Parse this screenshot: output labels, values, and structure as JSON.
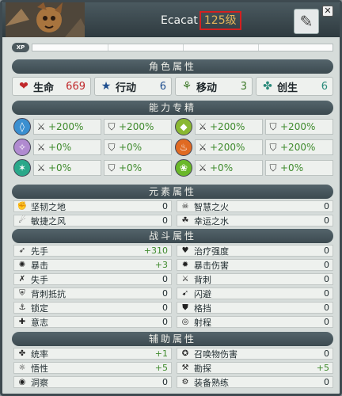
{
  "header": {
    "name": "Ecacat",
    "level": "125级"
  },
  "xp": {
    "badge": "XP"
  },
  "sections": {
    "character": "角色属性",
    "abilities": "能力专精",
    "elemental": "元素属性",
    "combat": "战斗属性",
    "support": "辅助属性"
  },
  "primary": [
    {
      "label": "生命",
      "value": "669",
      "color": "#c0282a",
      "icon": "heart-icon"
    },
    {
      "label": "行动",
      "value": "6",
      "color": "#1f4f8f",
      "icon": "star-icon"
    },
    {
      "label": "移动",
      "value": "3",
      "color": "#3e7a2a",
      "icon": "boot-icon"
    },
    {
      "label": "创生",
      "value": "6",
      "color": "#2a8a7a",
      "icon": "wakfu-icon"
    }
  ],
  "elements": [
    {
      "icon": "water-icon",
      "color": "#3a8fd0",
      "attack": "+200%",
      "defense": "+200%"
    },
    {
      "icon": "earth-icon",
      "color": "#8ab832",
      "attack": "+200%",
      "defense": "+200%"
    },
    {
      "icon": "light-icon",
      "color": "#b08ad0",
      "attack": "+0%",
      "defense": "+0%"
    },
    {
      "icon": "fire-icon",
      "color": "#e06a22",
      "attack": "+200%",
      "defense": "+200%"
    },
    {
      "icon": "wind-icon",
      "color": "#2aa88a",
      "attack": "+0%",
      "defense": "+0%"
    },
    {
      "icon": "nature-icon",
      "color": "#6ab82a",
      "attack": "+0%",
      "defense": "+0%"
    }
  ],
  "elemental_rows": [
    {
      "label": "坚韧之地",
      "value": "0"
    },
    {
      "label": "智慧之火",
      "value": "0"
    },
    {
      "label": "敏捷之风",
      "value": "0"
    },
    {
      "label": "幸运之水",
      "value": "0"
    }
  ],
  "combat_rows": [
    {
      "label": "先手",
      "value": "+310",
      "green": true
    },
    {
      "label": "治疗强度",
      "value": "0"
    },
    {
      "label": "暴击",
      "value": "+3",
      "green": true
    },
    {
      "label": "暴击伤害",
      "value": "0"
    },
    {
      "label": "失手",
      "value": "0"
    },
    {
      "label": "背刺",
      "value": "0"
    },
    {
      "label": "背刺抵抗",
      "value": "0"
    },
    {
      "label": "闪避",
      "value": "0"
    },
    {
      "label": "锁定",
      "value": "0"
    },
    {
      "label": "格挡",
      "value": "0"
    },
    {
      "label": "意志",
      "value": "0"
    },
    {
      "label": "射程",
      "value": "0"
    }
  ],
  "support_rows": [
    {
      "label": "统率",
      "value": "+1",
      "green": true
    },
    {
      "label": "召唤物伤害",
      "value": "0"
    },
    {
      "label": "悟性",
      "value": "+5",
      "green": true
    },
    {
      "label": "勘探",
      "value": "+5",
      "green": true
    },
    {
      "label": "洞察",
      "value": "0"
    },
    {
      "label": "装备熟练",
      "value": "0"
    }
  ]
}
